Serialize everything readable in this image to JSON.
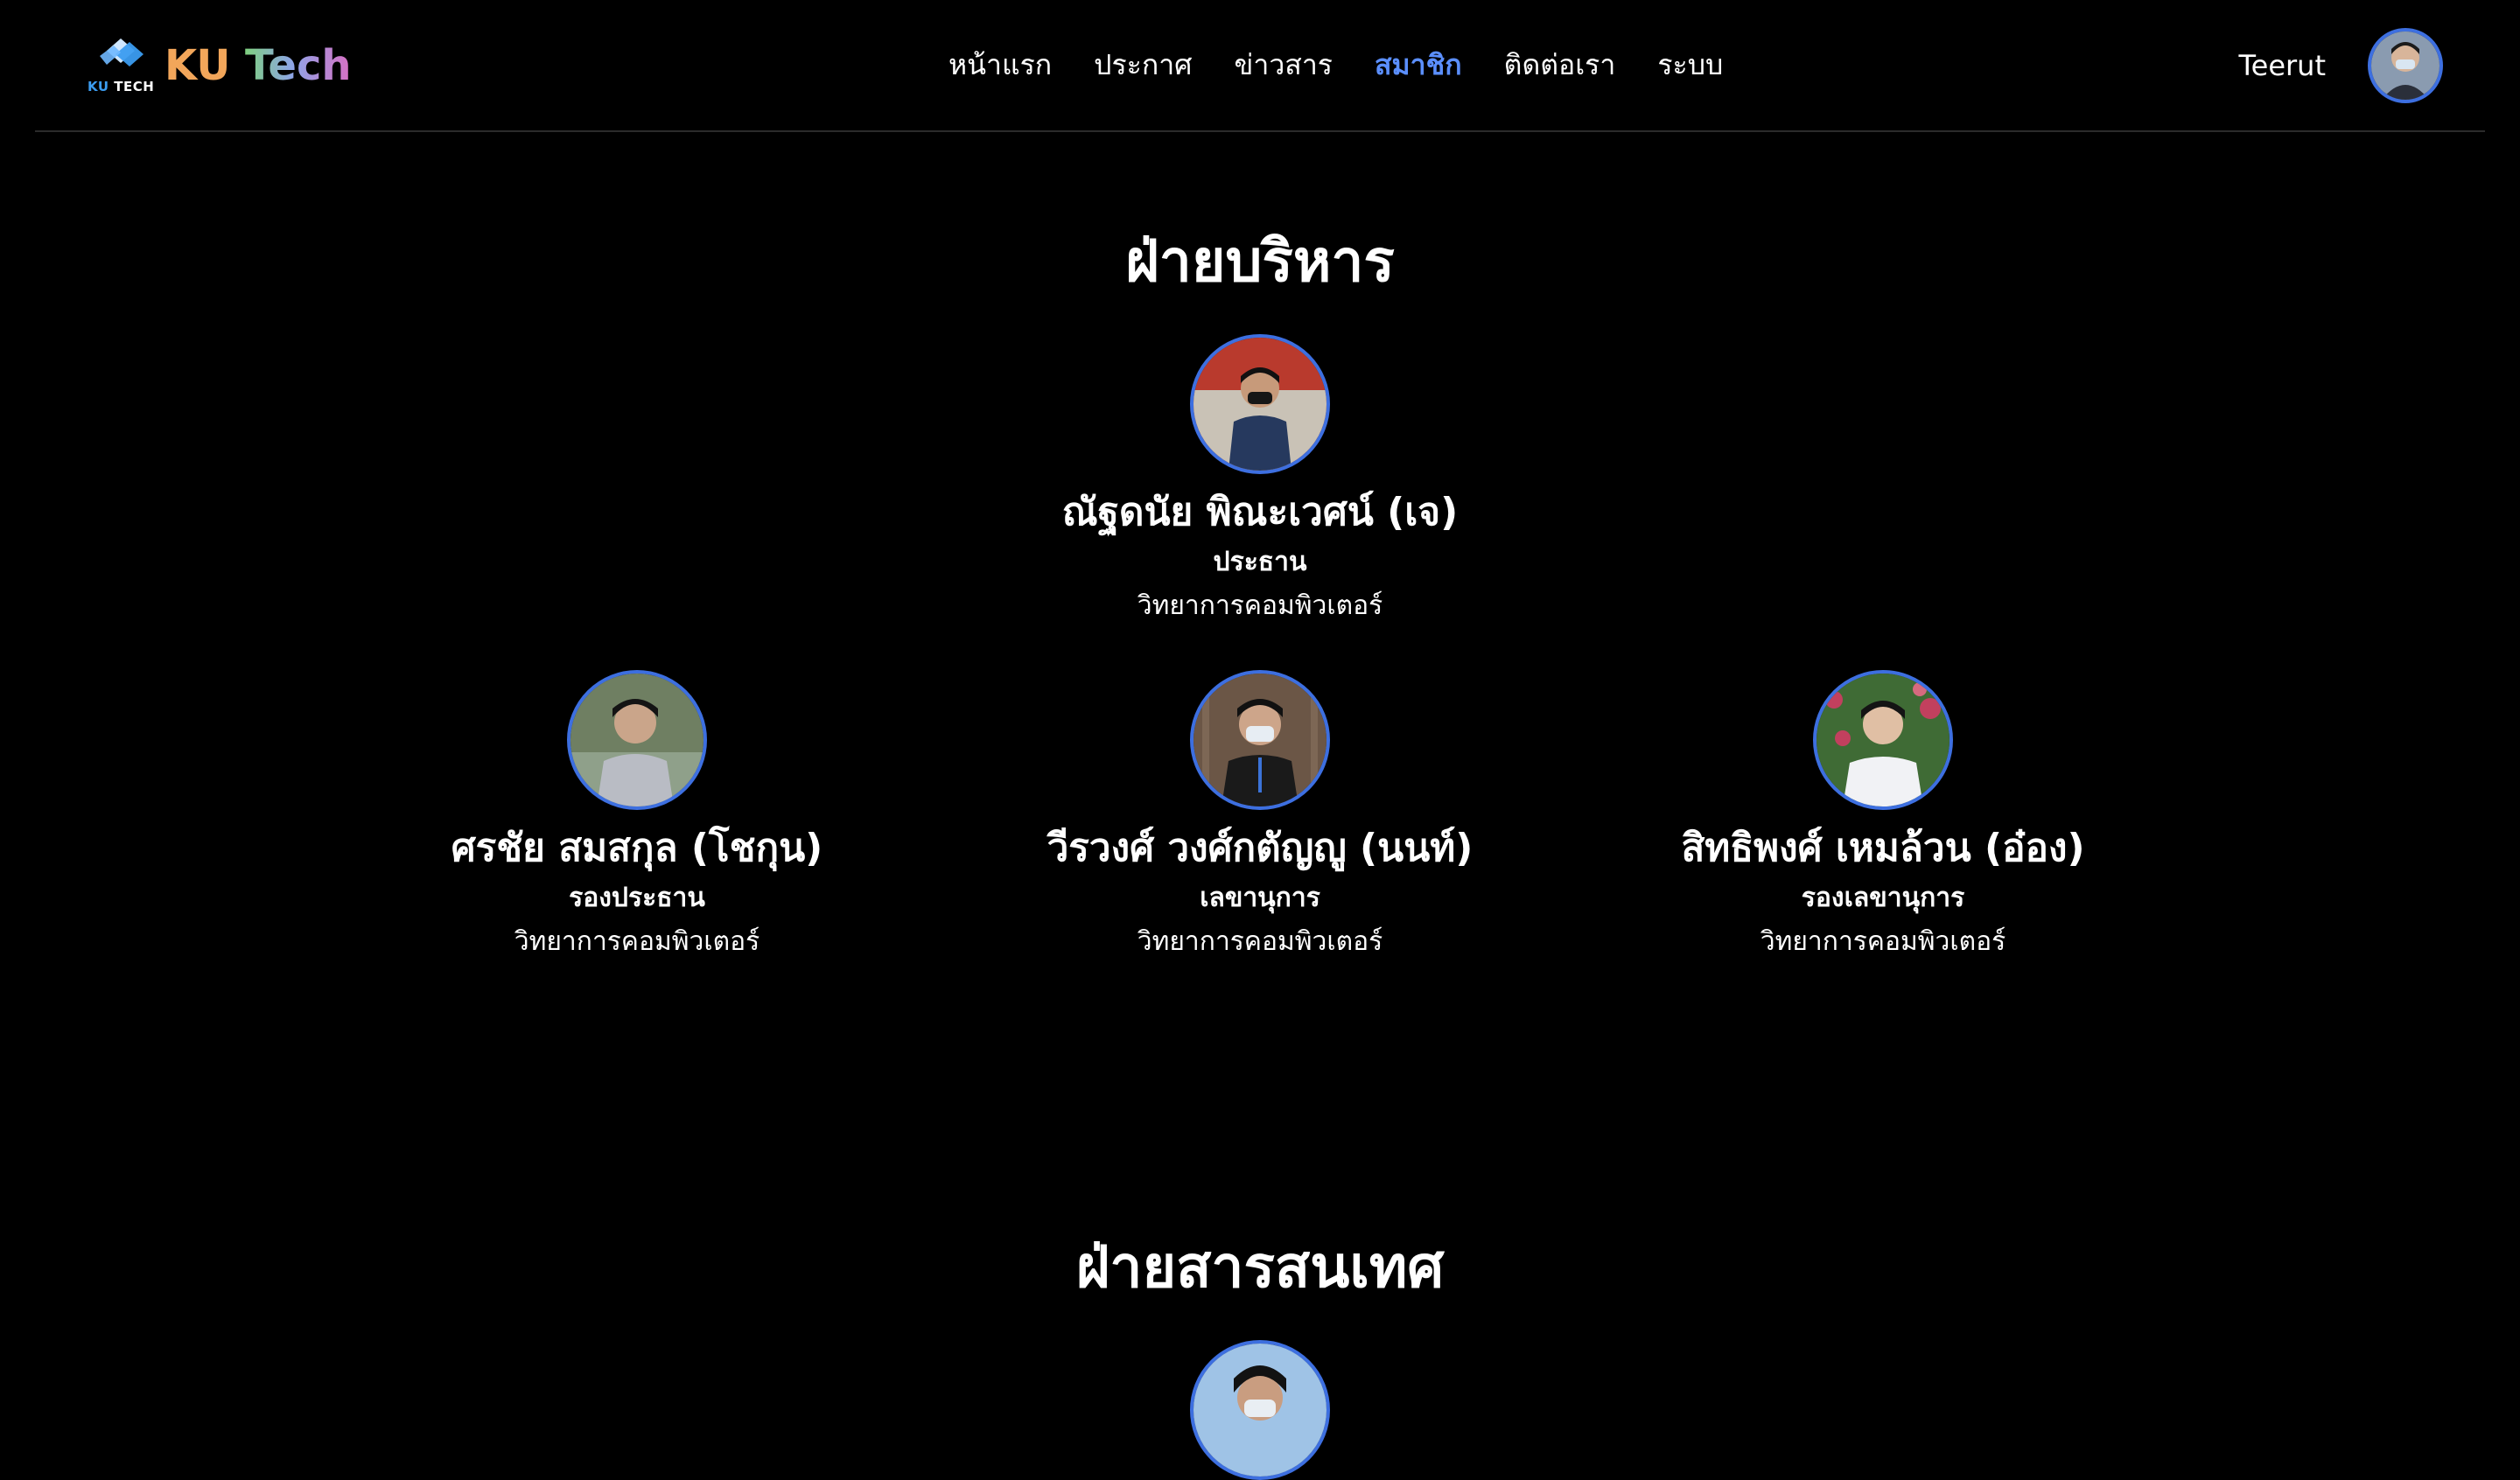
{
  "brand": {
    "mark_ku": "KU",
    "mark_tech": "TECH",
    "name_word1": "KU",
    "name_word2": "Tech"
  },
  "nav": {
    "items": [
      {
        "label": "หน้าแรก"
      },
      {
        "label": "ประกาศ"
      },
      {
        "label": "ข่าวสาร"
      },
      {
        "label": "สมาชิก"
      },
      {
        "label": "ติดต่อเรา"
      },
      {
        "label": "ระบบ"
      }
    ],
    "active_index": 3
  },
  "user": {
    "name": "Teerut"
  },
  "sections": [
    {
      "title": "ฝ่ายบริหาร",
      "members": [
        {
          "name": "ณัฐดนัย พิณะเวศน์ (เจ)",
          "role": "ประธาน",
          "dept": "วิทยาการคอมพิวเตอร์"
        },
        {
          "name": "ศรชัย สมสกุล (โชกุน)",
          "role": "รองประธาน",
          "dept": "วิทยาการคอมพิวเตอร์"
        },
        {
          "name": "วีรวงศ์ วงศ์กตัญญู (นนท์)",
          "role": "เลขานุการ",
          "dept": "วิทยาการคอมพิวเตอร์"
        },
        {
          "name": "สิทธิพงศ์ เหมล้วน (อ๋อง)",
          "role": "รองเลขานุการ",
          "dept": "วิทยาการคอมพิวเตอร์"
        }
      ]
    },
    {
      "title": "ฝ่ายสารสนเทศ",
      "members": []
    }
  ],
  "colors": {
    "background": "#000000",
    "accent": "#3d6fe0",
    "active_nav": "#5b8fff",
    "brand_orange": "#f2a65a"
  }
}
